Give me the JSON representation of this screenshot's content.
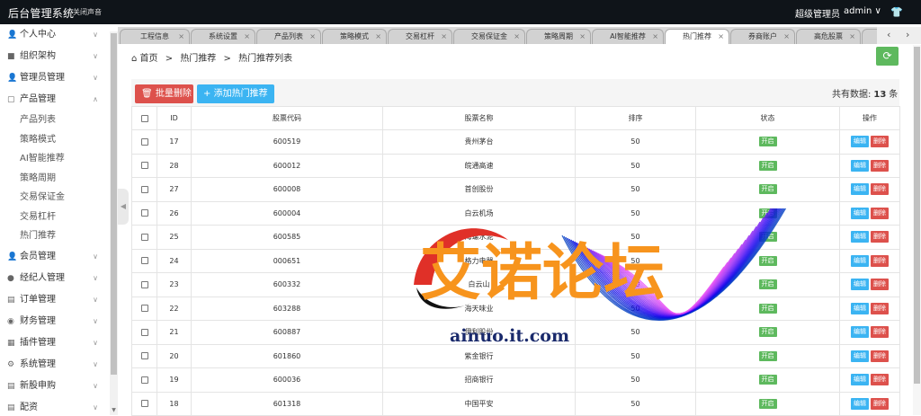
{
  "header": {
    "brand": "后台管理系统",
    "mute": "关闭声音",
    "role": "超级管理员",
    "user": "admin ∨",
    "shirt_icon": "shirt-icon"
  },
  "sidebar": {
    "items": [
      {
        "label": "个人中心",
        "icon": "user-icon",
        "expanded": false
      },
      {
        "label": "组织架构",
        "icon": "org-icon",
        "expanded": false
      },
      {
        "label": "管理员管理",
        "icon": "admin-icon",
        "expanded": false
      },
      {
        "label": "产品管理",
        "icon": "product-icon",
        "expanded": true,
        "children": [
          "产品列表",
          "策略模式",
          "AI智能推荐",
          "策略周期",
          "交易保证金",
          "交易杠杆",
          "热门推荐"
        ]
      },
      {
        "label": "会员管理",
        "icon": "member-icon",
        "expanded": false
      },
      {
        "label": "经纪人管理",
        "icon": "agent-icon",
        "expanded": false
      },
      {
        "label": "订单管理",
        "icon": "order-icon",
        "expanded": false
      },
      {
        "label": "财务管理",
        "icon": "finance-icon",
        "expanded": false
      },
      {
        "label": "插件管理",
        "icon": "plugin-icon",
        "expanded": false
      },
      {
        "label": "系统管理",
        "icon": "system-icon",
        "expanded": false
      },
      {
        "label": "新股申购",
        "icon": "ipo-icon",
        "expanded": false
      },
      {
        "label": "配资",
        "icon": "fund-icon",
        "expanded": false
      }
    ]
  },
  "tabs": [
    "工程信息",
    "系统设置",
    "产品列表",
    "策略模式",
    "交易杠杆",
    "交易保证金",
    "策略周期",
    "AI智能推荐",
    "热门推荐",
    "券商账户",
    "高危股票",
    "跟买"
  ],
  "active_tab": "热门推荐",
  "breadcrumb": {
    "home": "首页",
    "sep1": ">",
    "l1": "热门推荐",
    "sep2": ">",
    "l2": "热门推荐列表"
  },
  "toolbar": {
    "delete": "批量删除",
    "add": "添加热门推荐",
    "count_prefix": "共有数据:",
    "count": "13",
    "count_suffix": "条"
  },
  "table": {
    "headers": [
      "ID",
      "股票代码",
      "股票名称",
      "排序",
      "状态",
      "操作"
    ],
    "status_label": "开启",
    "edit_label": "编辑",
    "delete_label": "删除",
    "rows": [
      [
        "17",
        "600519",
        "贵州茅台",
        "50"
      ],
      [
        "28",
        "600012",
        "皖通高速",
        "50"
      ],
      [
        "27",
        "600008",
        "首创股份",
        "50"
      ],
      [
        "26",
        "600004",
        "白云机场",
        "50"
      ],
      [
        "25",
        "600585",
        "海螺水泥",
        "50"
      ],
      [
        "24",
        "000651",
        "格力电器",
        "50"
      ],
      [
        "23",
        "600332",
        "白云山",
        "50"
      ],
      [
        "22",
        "603288",
        "海天味业",
        "50"
      ],
      [
        "21",
        "600887",
        "伊利股份",
        "50"
      ],
      [
        "20",
        "601860",
        "紫金银行",
        "50"
      ],
      [
        "19",
        "600036",
        "招商银行",
        "50"
      ],
      [
        "18",
        "601318",
        "中国平安",
        "50"
      ]
    ]
  },
  "watermark": {
    "title": "艾诺论坛",
    "url": "ainuo.it.com"
  },
  "colors": {
    "topbar": "#0f1419",
    "green": "#5eb95e",
    "red": "#dd514c",
    "blue": "#3bb4f2",
    "watermark_orange": "#f7941d"
  }
}
